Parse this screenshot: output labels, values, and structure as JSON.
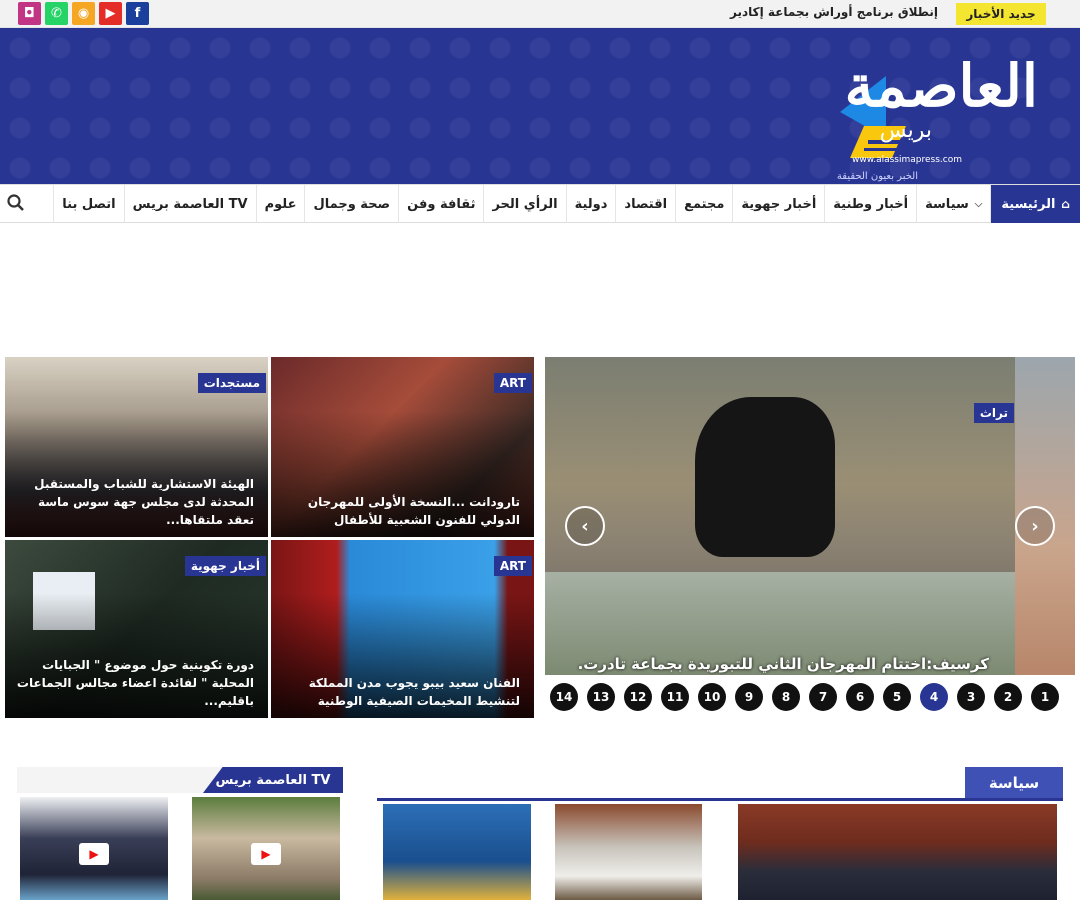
{
  "topbar": {
    "breaking_label": "جديد الأخبار",
    "breaking_text": "إنطلاق برنامج أوراش بجماعة إكادير",
    "social": [
      {
        "icon": "instagram-icon",
        "glyph": "◘",
        "color": "#c13584"
      },
      {
        "icon": "whatsapp-icon",
        "glyph": "✆",
        "color": "#25d366"
      },
      {
        "icon": "rss-icon",
        "glyph": "◉",
        "color": "#f5a623"
      },
      {
        "icon": "youtube-icon",
        "glyph": "▶",
        "color": "#e52d27"
      },
      {
        "icon": "facebook-icon",
        "glyph": "f",
        "color": "#1b3f9c"
      }
    ]
  },
  "header": {
    "logo_main": "العاصمة",
    "logo_sub": "بريس",
    "logo_url": "www.alassimapress.com",
    "logo_tagline": "الخبر بعيون الحقيقة"
  },
  "nav": {
    "items": [
      "الرئيسية",
      "سياسة",
      "أخبار وطنية",
      "أخبار جهوية",
      "مجتمع",
      "اقتصاد",
      "دولية",
      "الرأي الحر",
      "ثقافة وفن",
      "صحة وجمال",
      "علوم",
      "العاصمة بريس TV",
      "اتصل بنا"
    ],
    "home_icon": "home-icon",
    "dropdown_icon": "chevron-down-icon",
    "search_icon": "search-icon"
  },
  "grid": [
    {
      "category": "ART",
      "title": "تارودانت ...النسخة الأولى للمهرجان الدولي للفنون الشعبية للأطفال"
    },
    {
      "category": "مستجدات",
      "title": "الهيئة الاستشارية للشباب والمستقبل المحدثة لدى مجلس جهة سوس ماسة تعقد ملتقاها..."
    },
    {
      "category": "ART",
      "title": "الفنان سعيد بيبو يجوب مدن المملكة لتنشيط المخيمات الصيفية الوطنية"
    },
    {
      "category": "أخبار جهوية",
      "title": "دورة تكوينية حول موضوع \" الجبايات المحلية \" لفائدة اعضاء مجالس الجماعات باقليم..."
    }
  ],
  "slider": {
    "category": "تراث",
    "title": "كرسيف:اختتام المهرجان الثاني للتبوريدة بجماعة تادرت.",
    "pages": [
      "1",
      "2",
      "3",
      "4",
      "5",
      "6",
      "7",
      "8",
      "9",
      "10",
      "11",
      "12",
      "13",
      "14"
    ],
    "active_page": "4"
  },
  "tv": {
    "title": "العاصمة بريس TV"
  },
  "politics": {
    "title": "سياسة"
  }
}
